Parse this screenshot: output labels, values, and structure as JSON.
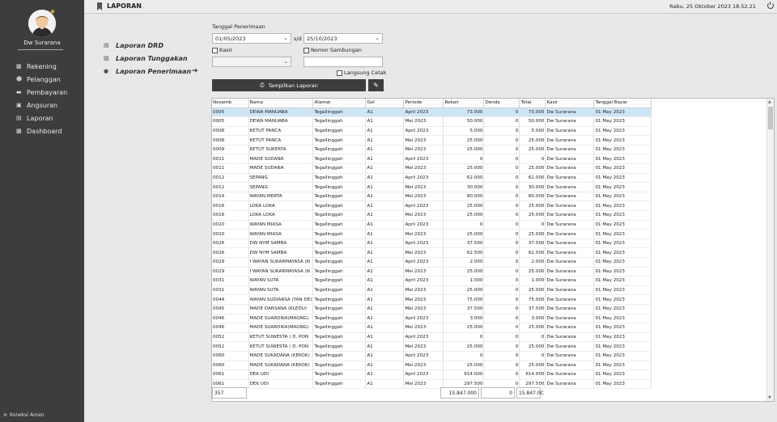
{
  "user": {
    "name": "Dw Surarana"
  },
  "sidebar": {
    "items": [
      {
        "label": "Rekening",
        "icon": "grid-icon"
      },
      {
        "label": "Pelanggan",
        "icon": "users-icon"
      },
      {
        "label": "Pembayaran",
        "icon": "money-icon"
      },
      {
        "label": "Angsuran",
        "icon": "calendar-icon"
      },
      {
        "label": "Laporan",
        "icon": "document-icon"
      },
      {
        "label": "Dashboard",
        "icon": "dashboard-icon"
      }
    ],
    "connection": "Koneksi Aman"
  },
  "header": {
    "title": "LAPORAN",
    "datetime": "Rabu, 25 Oktober 2023  18.52.21"
  },
  "reports": [
    {
      "label": "Laporan DRD",
      "icon": "document-icon"
    },
    {
      "label": "Laporan Tunggakan",
      "icon": "layers-icon"
    },
    {
      "label": "Laporan Penerimaan",
      "icon": "moneybag-icon"
    }
  ],
  "filters": {
    "tanggal_label": "Tanggal Penerimaan",
    "date_from": "01/05/2023",
    "sd_label": "s/d",
    "date_to": "25/10/2023",
    "kasir_label": "Kasir",
    "nomor_label": "Nomor Sambungan",
    "kasir_value": "",
    "nomor_value": "",
    "langsung_label": "Langsung Cetak",
    "show_button": "Tampilkan Laporan"
  },
  "table": {
    "columns": [
      "Nosamb",
      "Nama",
      "Alamat",
      "Gol",
      "Periode",
      "Rekair",
      "Denda",
      "Total",
      "Kasir",
      "Tanggal Bayar"
    ],
    "rows": [
      [
        "0005",
        "DEWA MANUABA",
        "Tegallinggah",
        "A1",
        "April 2023",
        "73.000",
        "0",
        "73.000",
        "Dw Surarana",
        "01 May 2023"
      ],
      [
        "0005",
        "DEWA MANUABA",
        "Tegallinggah",
        "A1",
        "Mei 2023",
        "50.000",
        "0",
        "50.000",
        "Dw Surarana",
        "01 May 2023"
      ],
      [
        "0008",
        "KETUT PANCA",
        "Tegallinggah",
        "A1",
        "April 2023",
        "5.000",
        "0",
        "5.000",
        "Dw Surarana",
        "01 May 2023"
      ],
      [
        "0008",
        "KETUT PANCA",
        "Tegallinggah",
        "A1",
        "Mei 2023",
        "25.000",
        "0",
        "25.000",
        "Dw Surarana",
        "01 May 2023"
      ],
      [
        "0009",
        "KETUT SUKERTA",
        "Tegallinggah",
        "A1",
        "Mei 2023",
        "25.000",
        "0",
        "25.000",
        "Dw Surarana",
        "01 May 2023"
      ],
      [
        "0011",
        "MADE SUDANA",
        "Tegallinggah",
        "A1",
        "April 2023",
        "0",
        "0",
        "0",
        "Dw Surarana",
        "01 May 2023"
      ],
      [
        "0011",
        "MADE SUDANA",
        "Tegallinggah",
        "A1",
        "Mei 2023",
        "25.000",
        "0",
        "25.000",
        "Dw Surarana",
        "01 May 2023"
      ],
      [
        "0012",
        "SEPANG",
        "Tegallinggah",
        "A1",
        "April 2023",
        "62.000",
        "0",
        "62.000",
        "Dw Surarana",
        "01 May 2023"
      ],
      [
        "0012",
        "SEPANG",
        "Tegallinggah",
        "A1",
        "Mei 2023",
        "30.000",
        "0",
        "30.000",
        "Dw Surarana",
        "01 May 2023"
      ],
      [
        "0014",
        "WAYAN MERTA",
        "Tegallinggah",
        "A1",
        "Mei 2023",
        "80.000",
        "0",
        "80.000",
        "Dw Surarana",
        "01 May 2023"
      ],
      [
        "0016",
        "LOKA LOKA",
        "Tegallinggah",
        "A1",
        "April 2023",
        "25.000",
        "0",
        "25.000",
        "Dw Surarana",
        "01 May 2023"
      ],
      [
        "0016",
        "LOKA LOKA",
        "Tegallinggah",
        "A1",
        "Mei 2023",
        "25.000",
        "0",
        "25.000",
        "Dw Surarana",
        "01 May 2023"
      ],
      [
        "0020",
        "WAYAN MIASA",
        "Tegallinggah",
        "A1",
        "April 2023",
        "0",
        "0",
        "0",
        "Dw Surarana",
        "01 May 2023"
      ],
      [
        "0020",
        "WAYAN MIASA",
        "Tegallinggah",
        "A1",
        "Mei 2023",
        "25.000",
        "0",
        "25.000",
        "Dw Surarana",
        "01 May 2023"
      ],
      [
        "0026",
        "DW NYM SAMBA",
        "Tegallinggah",
        "A1",
        "April 2023",
        "37.500",
        "0",
        "37.500",
        "Dw Surarana",
        "01 May 2023"
      ],
      [
        "0026",
        "DW NYM SAMBA",
        "Tegallinggah",
        "A1",
        "Mei 2023",
        "62.500",
        "0",
        "62.500",
        "Dw Surarana",
        "01 May 2023"
      ],
      [
        "0029",
        "I WAYAN SUKARMAYASA (N",
        "Tegallinggah",
        "A1",
        "April 2023",
        "2.000",
        "0",
        "2.000",
        "Dw Surarana",
        "01 May 2023"
      ],
      [
        "0029",
        "I WAYAN SUKARMAYASA (N",
        "Tegallinggah",
        "A1",
        "Mei 2023",
        "25.000",
        "0",
        "25.000",
        "Dw Surarana",
        "01 May 2023"
      ],
      [
        "0031",
        "WAYAN SUTA",
        "Tegallinggah",
        "A1",
        "April 2023",
        "1.000",
        "0",
        "1.000",
        "Dw Surarana",
        "01 May 2023"
      ],
      [
        "0031",
        "WAYAN SUTA",
        "Tegallinggah",
        "A1",
        "Mei 2023",
        "25.000",
        "0",
        "25.000",
        "Dw Surarana",
        "01 May 2023"
      ],
      [
        "0044",
        "WAYAN SUDIARSA (YAN DE)",
        "Tegallinggah",
        "A1",
        "Mei 2023",
        "75.000",
        "0",
        "75.000",
        "Dw Surarana",
        "01 May 2023"
      ],
      [
        "0045",
        "MADE DARSANA (KLEDU)",
        "Tegallinggah",
        "A1",
        "Mei 2023",
        "37.500",
        "0",
        "37.500",
        "Dw Surarana",
        "01 May 2023"
      ],
      [
        "0046",
        "MADE SUARDIKA(MAONG)",
        "Tegallinggah",
        "A1",
        "April 2023",
        "3.000",
        "0",
        "3.000",
        "Dw Surarana",
        "01 May 2023"
      ],
      [
        "0046",
        "MADE SUARDIKA(MAONG)",
        "Tegallinggah",
        "A1",
        "Mei 2023",
        "25.000",
        "0",
        "25.000",
        "Dw Surarana",
        "01 May 2023"
      ],
      [
        "0052",
        "KETUT SUWESTA ( D. PON",
        "Tegallinggah",
        "A1",
        "April 2023",
        "0",
        "0",
        "0",
        "Dw Surarana",
        "01 May 2023"
      ],
      [
        "0052",
        "KETUT SUWESTA ( D. PON",
        "Tegallinggah",
        "A1",
        "Mei 2023",
        "25.000",
        "0",
        "25.000",
        "Dw Surarana",
        "01 May 2023"
      ],
      [
        "0060",
        "MADE SUKADANA (KEKOK)",
        "Tegallinggah",
        "A1",
        "April 2023",
        "0",
        "0",
        "0",
        "Dw Surarana",
        "01 May 2023"
      ],
      [
        "0060",
        "MADE SUKADANA (KEKOK)",
        "Tegallinggah",
        "A1",
        "Mei 2023",
        "25.000",
        "0",
        "25.000",
        "Dw Surarana",
        "01 May 2023"
      ],
      [
        "0061",
        "DEK UDI",
        "Tegallinggah",
        "A1",
        "April 2023",
        "614.000",
        "0",
        "614.000",
        "Dw Surarana",
        "01 May 2023"
      ],
      [
        "0061",
        "DEK UDI",
        "Tegallinggah",
        "A1",
        "Mei 2023",
        "297.500",
        "0",
        "297.500",
        "Dw Surarana",
        "01 May 2023"
      ]
    ],
    "selected_row": 0
  },
  "totals": {
    "count": "357",
    "rekair": "15.847.000",
    "denda": "0",
    "total": "15.847.0C"
  },
  "colors": {
    "sidebar_bg": "#3d3d3d",
    "selected_row": "#cde6f7"
  }
}
